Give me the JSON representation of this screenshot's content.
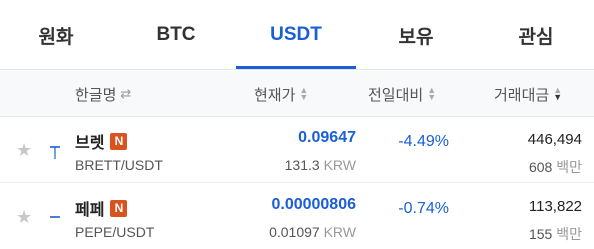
{
  "tabs": [
    {
      "label": "원화"
    },
    {
      "label": "BTC"
    },
    {
      "label": "USDT"
    },
    {
      "label": "보유"
    },
    {
      "label": "관심"
    }
  ],
  "active_tab": "USDT",
  "colors": {
    "accent": "#1a5fd6",
    "badge": "#d9531e",
    "fall": "#1a5fd6"
  },
  "header": {
    "name": "한글명",
    "price": "현재가",
    "change": "전일대비",
    "volume": "거래대금"
  },
  "rows": [
    {
      "name": "브렛",
      "badge": "N",
      "pair": "BRETT/USDT",
      "price": "0.09647",
      "krw_value": "131.3",
      "krw_unit": "KRW",
      "change": "-4.49%",
      "volume_usdt": "446,494",
      "volume_krw": "608",
      "volume_unit": "백만"
    },
    {
      "name": "페페",
      "badge": "N",
      "pair": "PEPE/USDT",
      "price": "0.00000806",
      "krw_value": "0.01097",
      "krw_unit": "KRW",
      "change": "-0.74%",
      "volume_usdt": "113,822",
      "volume_krw": "155",
      "volume_unit": "백만"
    }
  ]
}
